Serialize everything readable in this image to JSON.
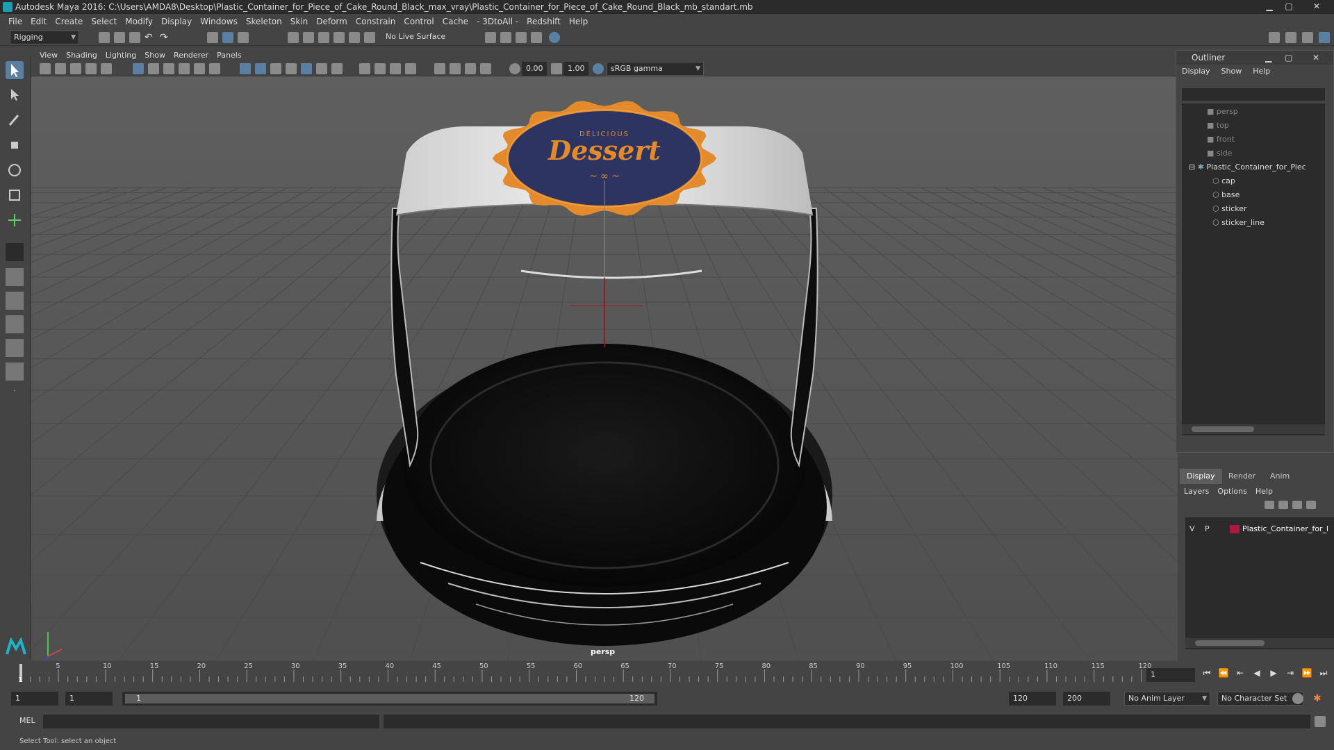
{
  "window": {
    "title": "Autodesk Maya 2016: C:\\Users\\AMDA8\\Desktop\\Plastic_Container_for_Piece_of_Cake_Round_Black_max_vray\\Plastic_Container_for_Piece_of_Cake_Round_Black_mb_standart.mb"
  },
  "menubar": [
    "File",
    "Edit",
    "Create",
    "Select",
    "Modify",
    "Display",
    "Windows",
    "Skeleton",
    "Skin",
    "Deform",
    "Constrain",
    "Control",
    "Cache",
    "- 3DtoAll -",
    "Redshift",
    "Help"
  ],
  "shelf": {
    "mode": "Rigging",
    "live_surface": "No Live Surface"
  },
  "viewport": {
    "menu": [
      "View",
      "Shading",
      "Lighting",
      "Show",
      "Renderer",
      "Panels"
    ],
    "exposure": "0.00",
    "gamma": "1.00",
    "color_space": "sRGB gamma",
    "camera_label": "persp",
    "sticker": {
      "top": "DELICIOUS",
      "main": "Dessert",
      "ornament": "~ ∞ ~"
    }
  },
  "outliner": {
    "title": "Outliner",
    "menu": [
      "Display",
      "Show",
      "Help"
    ],
    "cameras": [
      "persp",
      "top",
      "front",
      "side"
    ],
    "group": "Plastic_Container_for_Piec",
    "children": [
      "cap",
      "base",
      "sticker",
      "sticker_line"
    ]
  },
  "layers": {
    "tabs": [
      "Display",
      "Render",
      "Anim"
    ],
    "menu": [
      "Layers",
      "Options",
      "Help"
    ],
    "row": {
      "v": "V",
      "p": "P",
      "name": "Plastic_Container_for_l",
      "color": "#b0173c"
    }
  },
  "timeline": {
    "ticks": [
      "5",
      "10",
      "15",
      "20",
      "25",
      "30",
      "35",
      "40",
      "45",
      "50",
      "55",
      "60",
      "65",
      "70",
      "75",
      "80",
      "85",
      "90",
      "95",
      "100",
      "105",
      "110",
      "115",
      "120"
    ],
    "start_marker": "1",
    "current_frame": "1"
  },
  "range": {
    "start": "1",
    "start2": "1",
    "slider_start": "1",
    "slider_end": "120",
    "end": "120",
    "max": "200",
    "anim_layer": "No Anim Layer",
    "char_set": "No Character Set"
  },
  "mel": {
    "label": "MEL"
  },
  "helpline": "Select Tool: select an object"
}
